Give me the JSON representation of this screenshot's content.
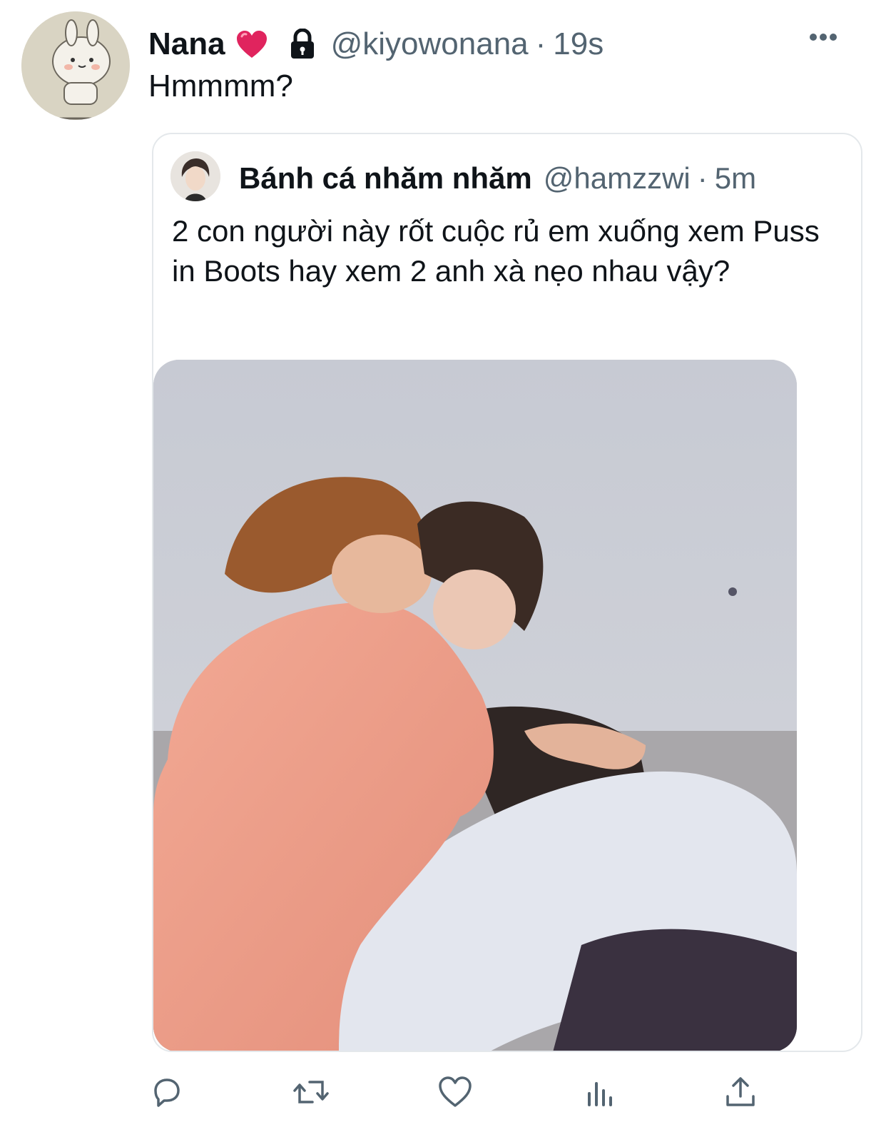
{
  "tweet": {
    "name": "Nana",
    "handle": "@kiyowonana",
    "separator": "·",
    "time": "19s",
    "text": "Hmmmm?",
    "icons": {
      "verified_emoji": "heart-icon",
      "protected": "lock-icon",
      "menu": "more-icon"
    }
  },
  "quoted_tweet": {
    "name": "Bánh cá nhăm nhăm",
    "handle": "@hamzzwi",
    "separator": "·",
    "time": "5m",
    "text": "2 con người này rốt cuộc rủ em xuống xem Puss in Boots hay xem 2 anh xà nẹo nhau vậy?"
  },
  "actions": [
    {
      "name": "reply",
      "icon": "reply-icon"
    },
    {
      "name": "retweet",
      "icon": "retweet-icon"
    },
    {
      "name": "like",
      "icon": "heart-outline-icon"
    },
    {
      "name": "analytics",
      "icon": "analytics-icon"
    },
    {
      "name": "share",
      "icon": "share-icon"
    }
  ],
  "colors": {
    "text": "#0f1419",
    "secondary": "#536471",
    "border": "#e4e8eb",
    "heart": "#e0245e",
    "icon": "#536471"
  }
}
